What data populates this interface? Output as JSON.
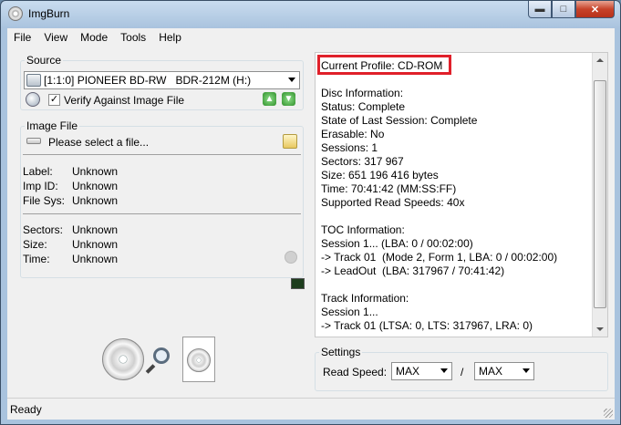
{
  "window": {
    "title": "ImgBurn"
  },
  "menu": [
    "File",
    "View",
    "Mode",
    "Tools",
    "Help"
  ],
  "source": {
    "legend": "Source",
    "drive": "[1:1:0] PIONEER BD-RW   BDR-212M (H:)",
    "verify_label": "Verify Against Image File",
    "verify_checked": true
  },
  "image_file": {
    "legend": "Image File",
    "placeholder": "Please select a file...",
    "fields": [
      {
        "label": "Label:",
        "value": "Unknown"
      },
      {
        "label": "Imp ID:",
        "value": "Unknown"
      },
      {
        "label": "File Sys:",
        "value": "Unknown"
      }
    ],
    "fields2": [
      {
        "label": "Sectors:",
        "value": "Unknown"
      },
      {
        "label": "Size:",
        "value": "Unknown"
      },
      {
        "label": "Time:",
        "value": "Unknown"
      }
    ]
  },
  "info": {
    "lines": [
      "Current Profile: CD-ROM",
      "",
      "Disc Information:",
      "Status: Complete",
      "State of Last Session: Complete",
      "Erasable: No",
      "Sessions: 1",
      "Sectors: 317 967",
      "Size: 651 196 416 bytes",
      "Time: 70:41:42 (MM:SS:FF)",
      "Supported Read Speeds: 40x",
      "",
      "TOC Information:",
      "Session 1... (LBA: 0 / 00:02:00)",
      "-> Track 01  (Mode 2, Form 1, LBA: 0 / 00:02:00)",
      "-> LeadOut  (LBA: 317967 / 70:41:42)",
      "",
      "Track Information:",
      "Session 1...",
      "-> Track 01 (LTSA: 0, LTS: 317967, LRA: 0)"
    ],
    "highlight_color": "#e0202a"
  },
  "settings": {
    "legend": "Settings",
    "read_speed_label": "Read Speed:",
    "speed1": "MAX",
    "separator": "/",
    "speed2": "MAX"
  },
  "status": {
    "text": "Ready"
  }
}
